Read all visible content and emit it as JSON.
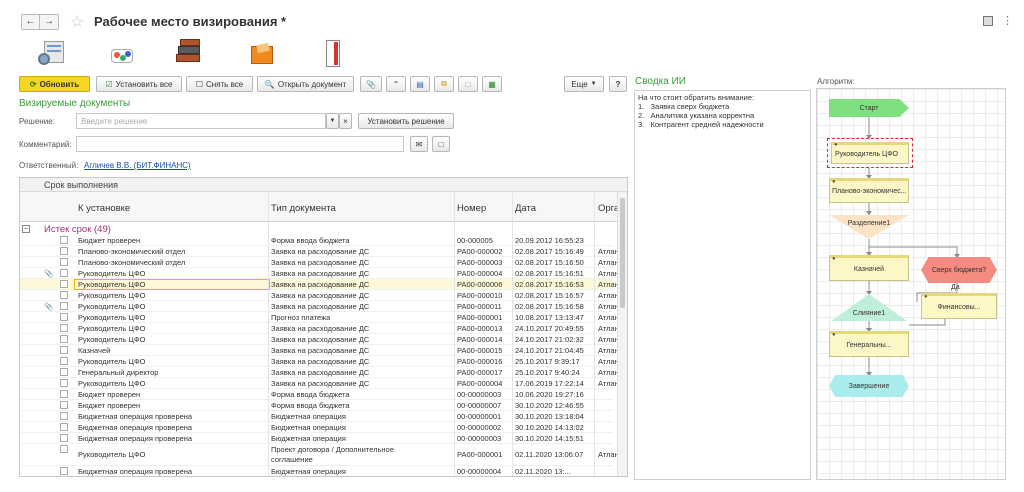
{
  "window": {
    "title": "Рабочее место визирования *"
  },
  "toolbar": {
    "refresh": "Обновить",
    "set_all": "Установить все",
    "clear_all": "Снять все",
    "open_doc": "Открыть документ",
    "more": "Еще",
    "help": "?"
  },
  "form": {
    "section_title": "Визируемые документы",
    "decision_label": "Решение:",
    "decision_placeholder": "Введите решение",
    "set_decision": "Установить решение",
    "comment_label": "Комментарий:",
    "responsible_label": "Ответственный:",
    "responsible_value": "Агличев В.В. (БИТ.ФИНАНС)"
  },
  "table": {
    "group_header": "Срок выполнения",
    "columns": [
      "К установке",
      "Тип документа",
      "Номер",
      "Дата",
      "Орга"
    ],
    "group_label": "Истек срок (49)",
    "rows": [
      {
        "step": "Бюджет проверен",
        "type": "Форма ввода бюджета",
        "num": "00-000005",
        "date": "20.09.2012 16:55:23",
        "org": ""
      },
      {
        "step": "Планово-экономический отдел",
        "type": "Заявка на расходование ДС",
        "num": "РА00-000002",
        "date": "02.08.2017 15:16:49",
        "org": "Атлан"
      },
      {
        "step": "Планово-экономический отдел",
        "type": "Заявка на расходование ДС",
        "num": "РА00-000003",
        "date": "02.08.2017 15:16:50",
        "org": "Атлан"
      },
      {
        "step": "Руководитель ЦФО",
        "type": "Заявка на расходование ДС",
        "num": "РА00-000004",
        "date": "02.08.2017 15:16:51",
        "org": "Атлан"
      },
      {
        "step": "Руководитель ЦФО",
        "type": "Заявка на расходование ДС",
        "num": "РА00-000006",
        "date": "02.08.2017 15:16:53",
        "org": "Атлан"
      },
      {
        "step": "Руководитель ЦФО",
        "type": "Заявка на расходование ДС",
        "num": "РА00-000010",
        "date": "02.08.2017 15:16:57",
        "org": "Атлан"
      },
      {
        "step": "Руководитель ЦФО",
        "type": "Заявка на расходование ДС",
        "num": "РА00-000011",
        "date": "02.08.2017 15:16:58",
        "org": "Атлан"
      },
      {
        "step": "Руководитель ЦФО",
        "type": "Прогноз платежа",
        "num": "РА00-000001",
        "date": "10.08.2017 13:13:47",
        "org": "Атлан"
      },
      {
        "step": "Руководитель ЦФО",
        "type": "Заявка на расходование ДС",
        "num": "РА00-000013",
        "date": "24.10.2017 20:49:55",
        "org": "Атлан"
      },
      {
        "step": "Руководитель ЦФО",
        "type": "Заявка на расходование ДС",
        "num": "РА00-000014",
        "date": "24.10.2017 21:02:32",
        "org": "Атлан"
      },
      {
        "step": "Казначей",
        "type": "Заявка на расходование ДС",
        "num": "РА00-000015",
        "date": "24.10.2017 21:04:45",
        "org": "Атлан"
      },
      {
        "step": "Руководитель ЦФО",
        "type": "Заявка на расходование ДС",
        "num": "РА00-000016",
        "date": "25.10.2017 9:39:17",
        "org": "Атлан"
      },
      {
        "step": "Генеральный директор",
        "type": "Заявка на расходование ДС",
        "num": "РА00-000017",
        "date": "25.10.2017 9:40:24",
        "org": "Атлан"
      },
      {
        "step": "Руководитель ЦФО",
        "type": "Заявка на расходование ДС",
        "num": "РА00-000004",
        "date": "17.06.2019 17:22:14",
        "org": "Атлан"
      },
      {
        "step": "Бюджет проверен",
        "type": "Форма ввода бюджета",
        "num": "00-00000003",
        "date": "10.06.2020 19:27:16",
        "org": ""
      },
      {
        "step": "Бюджет проверен",
        "type": "Форма ввода бюджета",
        "num": "00-00000007",
        "date": "30.10.2020 12:46:55",
        "org": ""
      },
      {
        "step": "Бюджетная операция проверена",
        "type": "Бюджетная операция",
        "num": "00-00000001",
        "date": "30.10.2020 13:18:04",
        "org": ""
      },
      {
        "step": "Бюджетная операция проверена",
        "type": "Бюджетная операция",
        "num": "00-00000002",
        "date": "30.10.2020 14:13:02",
        "org": ""
      },
      {
        "step": "Бюджетная операция проверена",
        "type": "Бюджетная операция",
        "num": "00-00000003",
        "date": "30.10.2020 14:15:51",
        "org": ""
      },
      {
        "step": "Руководитель ЦФО",
        "type": "Проект договора / Дополнительное",
        "type2": "соглашение",
        "num": "РА00-000001",
        "date": "02.11.2020 13:06:07",
        "org": "Атлан"
      },
      {
        "step": "Бюджетная операция проверена",
        "type": "Бюджетная операция",
        "num": "00-00000004",
        "date": "02.11.2020 13:...",
        "org": ""
      }
    ]
  },
  "summary": {
    "title": "Сводка ИИ",
    "intro": "На что стоит обратить внимание:",
    "items": [
      "1.   Заявка сверх бюджета",
      "2.   Аналитика указана корректна",
      "3.   Контрагент средней надежности"
    ]
  },
  "algorithm": {
    "title": "Алгоритм:",
    "nodes": {
      "start": "Старт",
      "cfo": "Руководитель ЦФО",
      "plan": "Планово-экономичес...",
      "split": "Разделение1",
      "treasurer": "Казначей",
      "over_budget": "Сверх бюджета?",
      "yes": "Да",
      "merge": "Слияние1",
      "finance": "Финансовы...",
      "general": "Генеральны...",
      "end": "Завершение"
    }
  },
  "colors": {
    "accent_green": "#3a9b3a",
    "group_purple": "#a0307a",
    "refresh_yellow": "#f5d624",
    "start_green": "#7fe07f",
    "end_cyan": "#a9ecec",
    "decision_red": "#f58a80"
  }
}
